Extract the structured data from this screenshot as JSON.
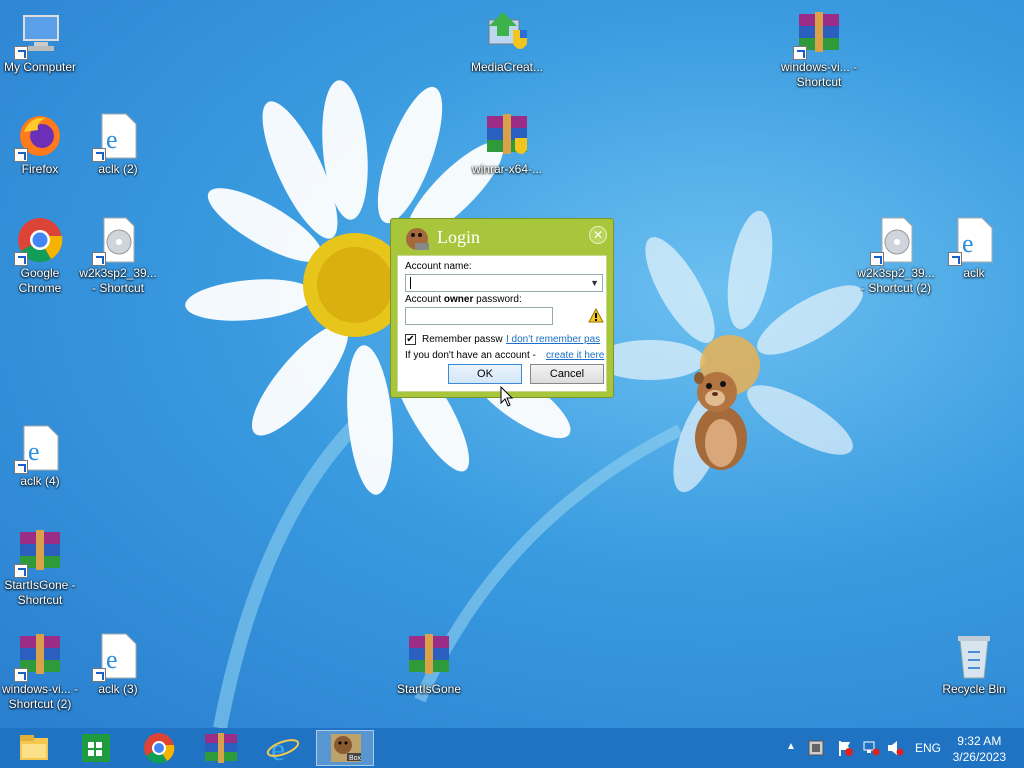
{
  "desktop": {
    "icons": [
      {
        "label": "My Computer",
        "type": "computer-icon"
      },
      {
        "label": "MediaCreat...",
        "type": "media-creation-icon"
      },
      {
        "label": "windows-vi... - Shortcut",
        "type": "winrar-icon"
      },
      {
        "label": "Firefox",
        "type": "firefox-icon"
      },
      {
        "label": "aclk (2)",
        "type": "ie-document-icon"
      },
      {
        "label": "winrar-x64-...",
        "type": "winrar-installer-icon"
      },
      {
        "label": "Google Chrome",
        "type": "chrome-icon"
      },
      {
        "label": "w2k3sp2_39... - Shortcut",
        "type": "disc-file-icon"
      },
      {
        "label": "w2k3sp2_39... - Shortcut (2)",
        "type": "disc-file-icon"
      },
      {
        "label": "aclk",
        "type": "ie-document-icon"
      },
      {
        "label": "aclk (4)",
        "type": "ie-document-icon"
      },
      {
        "label": "StartIsGone - Shortcut",
        "type": "winrar-icon"
      },
      {
        "label": "windows-vi... - Shortcut (2)",
        "type": "winrar-icon"
      },
      {
        "label": "aclk (3)",
        "type": "ie-document-icon"
      },
      {
        "label": "StartIsGone",
        "type": "winrar-icon"
      },
      {
        "label": "Recycle Bin",
        "type": "recycle-bin-icon"
      }
    ]
  },
  "dialog": {
    "title": "Login",
    "account_name_label": "Account name:",
    "account_name_value": "",
    "password_label_pre": "Account ",
    "password_label_bold": "owner",
    "password_label_post": " password:",
    "password_value": "",
    "remember_label": "Remember passw",
    "remember_checked": true,
    "forgot_link": "I don't remember pas",
    "no_account_text": "If you don't have an account -",
    "create_link": "create it here",
    "ok_label": "OK",
    "cancel_label": "Cancel"
  },
  "taskbar": {
    "items": [
      "file-explorer-icon",
      "store-icon",
      "chrome-icon",
      "winrar-icon",
      "ie-icon",
      "pass-box-icon"
    ],
    "active_item": "pass-box-icon",
    "language": "ENG",
    "time": "9:32 AM",
    "date": "3/26/2023"
  }
}
